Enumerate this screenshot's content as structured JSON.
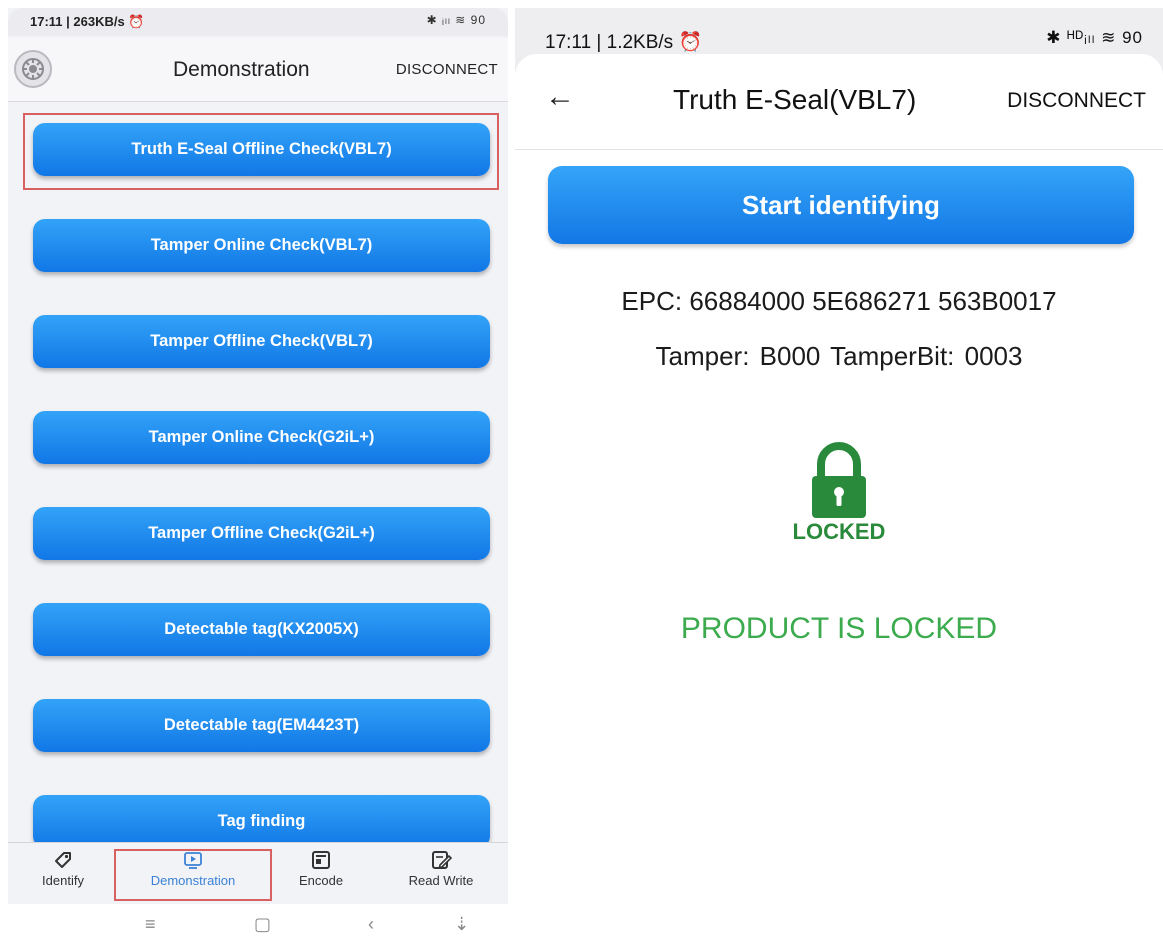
{
  "left": {
    "status_bar": {
      "time": "17:11 | 263KB/s ⏰",
      "icons": "✱ ᵢₗₗ ≋ 90"
    },
    "header": {
      "title": "Demonstration",
      "disconnect_label": "DISCONNECT",
      "menu_icon": "gear-icon"
    },
    "menu": [
      {
        "label": "Truth E-Seal Offline Check(VBL7)",
        "highlighted": true
      },
      {
        "label": "Tamper Online Check(VBL7)"
      },
      {
        "label": "Tamper Offline Check(VBL7)"
      },
      {
        "label": "Tamper Online Check(G2iL+)"
      },
      {
        "label": "Tamper Offline Check(G2iL+)"
      },
      {
        "label": "Detectable tag(KX2005X)"
      },
      {
        "label": "Detectable tag(EM4423T)"
      },
      {
        "label": "Tag finding"
      }
    ],
    "tabs": [
      {
        "label": "Identify",
        "icon": "tag-icon"
      },
      {
        "label": "Demonstration",
        "icon": "play-icon",
        "active": true
      },
      {
        "label": "Encode",
        "icon": "encode-icon"
      },
      {
        "label": "Read Write",
        "icon": "edit-icon"
      }
    ],
    "nav": {
      "menu": "≡",
      "home": "▢",
      "back": "‹",
      "down": "⇣"
    }
  },
  "right": {
    "status_bar": {
      "time": "17:11 | 1.2KB/s ⏰",
      "icons": "✱ ᴴᴰᵢₗₗ ≋ 90"
    },
    "header": {
      "back_icon": "←",
      "title": "Truth E-Seal(VBL7)",
      "disconnect_label": "DISCONNECT"
    },
    "start_button": "Start identifying",
    "epc": "EPC: 66884000 5E686271 563B0017",
    "tamper": "Tamper: B000  TamperBit: 0003",
    "lock_label": "LOCKED",
    "product_status": "PRODUCT IS LOCKED",
    "colors": {
      "lock_green": "#2a8a3b",
      "status_green": "#3cab4e",
      "button_blue": "#1f8bef"
    }
  }
}
